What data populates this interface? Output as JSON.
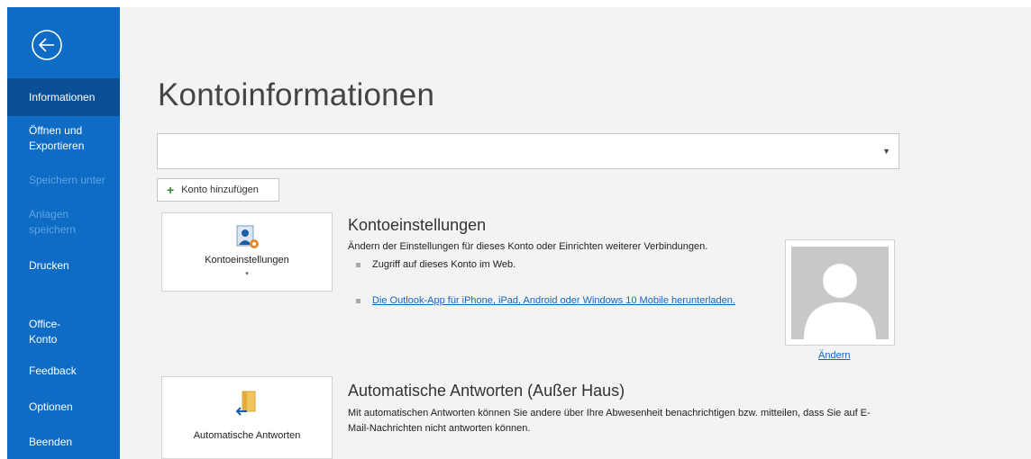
{
  "sidebar": {
    "items": [
      {
        "label": "Informationen",
        "state": "active"
      },
      {
        "label": "Öffnen und Exportieren",
        "state": "normal"
      },
      {
        "label": "Speichern unter",
        "state": "disabled"
      },
      {
        "label": "Anlagen speichern",
        "state": "disabled"
      },
      {
        "label": "Drucken",
        "state": "normal"
      },
      {
        "label": "Office-Konto",
        "state": "normal"
      },
      {
        "label": "Feedback",
        "state": "normal"
      },
      {
        "label": "Optionen",
        "state": "normal"
      },
      {
        "label": "Beenden",
        "state": "normal"
      }
    ],
    "back_icon": "back-arrow-circle-icon"
  },
  "main": {
    "title": "Kontoinformationen",
    "account_select": {
      "value": ""
    },
    "add_account_label": "Konto hinzufügen",
    "account_settings": {
      "tile_label": "Kontoeinstellungen",
      "title": "Kontoeinstellungen",
      "description": "Ändern der Einstellungen für dieses Konto oder Einrichten weiterer Verbindungen.",
      "bullets": [
        {
          "text": "Zugriff auf dieses Konto im Web."
        },
        {
          "text": "Die Outlook-App für iPhone, iPad, Android oder Windows 10 Mobile herunterladen."
        }
      ]
    },
    "profile": {
      "change_label": "Ändern"
    },
    "auto_replies": {
      "tile_label": "Automatische Antworten",
      "title": "Automatische Antworten (Außer Haus)",
      "description": "Mit automatischen Antworten können Sie andere über Ihre Abwesenheit benachrichtigen bzw. mitteilen, dass Sie auf E-Mail-Nachrichten nicht antworten können."
    }
  },
  "colors": {
    "sidebar": "#0f6cc4",
    "sidebar_active": "#0a4f98",
    "link": "#1565c0"
  }
}
